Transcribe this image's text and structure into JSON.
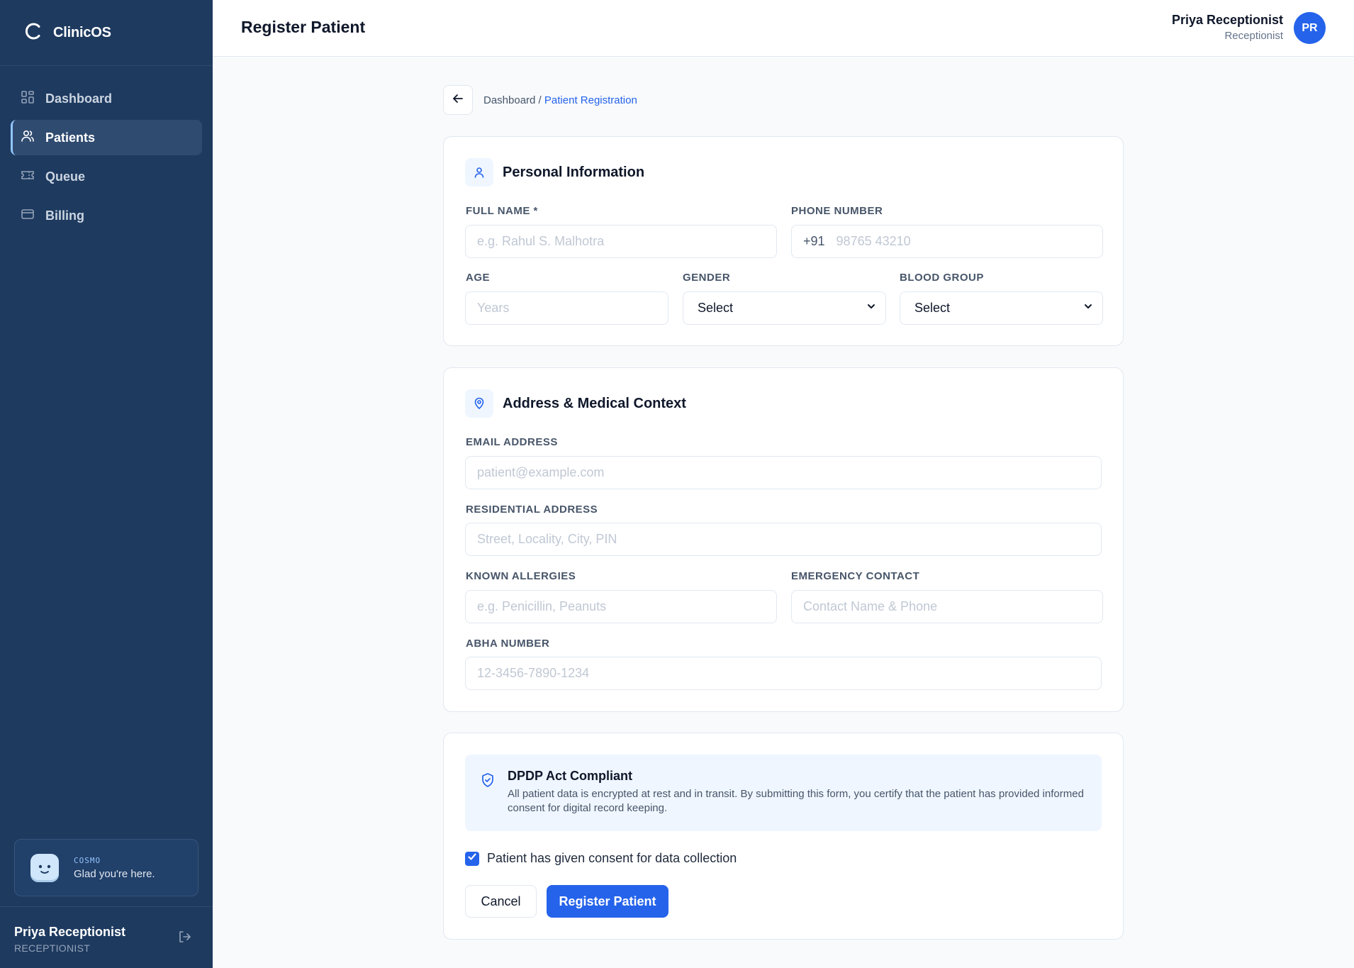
{
  "app": {
    "name": "ClinicOS",
    "page_title": "Register Patient"
  },
  "sidebar": {
    "items": [
      {
        "label": "Dashboard",
        "icon": "dashboard-grid-icon",
        "active": false
      },
      {
        "label": "Patients",
        "icon": "users-icon",
        "active": true
      },
      {
        "label": "Queue",
        "icon": "ticket-icon",
        "active": false
      },
      {
        "label": "Billing",
        "icon": "credit-card-icon",
        "active": false
      }
    ],
    "assistant": {
      "tag": "COSMO",
      "message": "Glad you're here."
    },
    "user": {
      "name": "Priya Receptionist",
      "role": "RECEPTIONIST"
    }
  },
  "header": {
    "user_name": "Priya Receptionist",
    "user_role": "Receptionist",
    "avatar_initials": "PR"
  },
  "breadcrumb": {
    "root": "Dashboard",
    "separator": " / ",
    "current": "Patient Registration"
  },
  "personal": {
    "title": "Personal Information",
    "full_name": {
      "label": "FULL NAME *",
      "placeholder": "e.g. Rahul S. Malhotra"
    },
    "phone": {
      "label": "PHONE NUMBER",
      "prefix": "+91",
      "placeholder": "98765 43210"
    },
    "age": {
      "label": "AGE",
      "placeholder": "Years"
    },
    "gender": {
      "label": "GENDER",
      "value": "Select"
    },
    "blood_group": {
      "label": "BLOOD GROUP",
      "value": "Select"
    }
  },
  "address": {
    "title": "Address & Medical Context",
    "email": {
      "label": "EMAIL ADDRESS",
      "placeholder": "patient@example.com"
    },
    "residential": {
      "label": "RESIDENTIAL ADDRESS",
      "placeholder": "Street, Locality, City, PIN"
    },
    "allergies": {
      "label": "KNOWN ALLERGIES",
      "placeholder": "e.g. Penicillin, Peanuts"
    },
    "emergency": {
      "label": "EMERGENCY CONTACT",
      "placeholder": "Contact Name & Phone"
    },
    "abha": {
      "label": "ABHA NUMBER",
      "placeholder": "12-3456-7890-1234"
    }
  },
  "compliance": {
    "title": "DPDP Act Compliant",
    "body": "All patient data is encrypted at rest and in transit. By submitting this form, you certify that the patient has provided informed consent for digital record keeping.",
    "consent_label": "Patient has given consent for data collection",
    "consent_checked": true,
    "cancel_label": "Cancel",
    "submit_label": "Register Patient"
  },
  "colors": {
    "sidebar_bg": "#1e3a5f",
    "accent": "#2563eb",
    "page_bg": "#f8fafc"
  }
}
